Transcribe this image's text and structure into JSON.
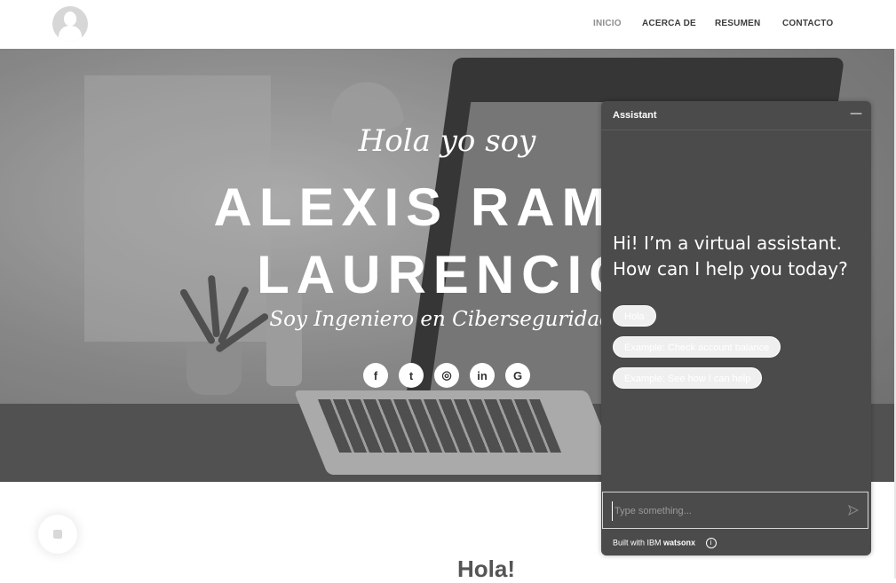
{
  "nav": {
    "items": [
      {
        "label": "INICIO",
        "active": true
      },
      {
        "label": "ACERCA DE",
        "active": false
      },
      {
        "label": "RESUMEN",
        "active": false
      },
      {
        "label": "CONTACTO",
        "active": false
      }
    ]
  },
  "hero": {
    "greeting": "Hola yo soy",
    "name_line1": "ALEXIS RAMIR",
    "name_line2": "LAURENCIO",
    "role": "Soy Ingeniero en Ciberseguridada",
    "socials": [
      {
        "icon": "facebook-icon",
        "glyph": "f"
      },
      {
        "icon": "twitter-icon",
        "glyph": "t"
      },
      {
        "icon": "instagram-icon",
        "glyph": "◎"
      },
      {
        "icon": "linkedin-icon",
        "glyph": "in"
      },
      {
        "icon": "google-icon",
        "glyph": "G"
      }
    ]
  },
  "section": {
    "heading": "Hola!"
  },
  "assistant": {
    "title": "Assistant",
    "minimize_glyph": "—",
    "message": "Hi! I’m a virtual assistant. How can I help you today?",
    "suggestions": [
      "Hola",
      "Example: Check account balance",
      "Example: See how I can help"
    ],
    "input_placeholder": "Type something...",
    "footer_prefix": "Built with IBM ",
    "footer_brand": "watsonx",
    "info_glyph": "i"
  }
}
